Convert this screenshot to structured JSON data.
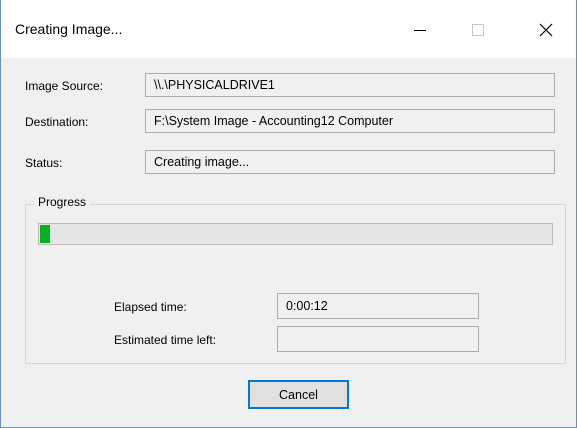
{
  "window": {
    "title": "Creating Image...",
    "controls": {
      "minimize": "minimize-icon",
      "maximize": "maximize-icon",
      "close": "close-icon"
    }
  },
  "fields": {
    "source_label": "Image Source:",
    "source_value": "\\\\.\\PHYSICALDRIVE1",
    "destination_label": "Destination:",
    "destination_value": "F:\\System Image - Accounting12 Computer",
    "status_label": "Status:",
    "status_value": "Creating image..."
  },
  "progress": {
    "group_title": "Progress",
    "fraction": 0.015,
    "color": "#06b025"
  },
  "times": {
    "elapsed_label": "Elapsed time:",
    "elapsed_value": "0:00:12",
    "remaining_label": "Estimated time left:",
    "remaining_value": ""
  },
  "buttons": {
    "cancel": "Cancel"
  }
}
